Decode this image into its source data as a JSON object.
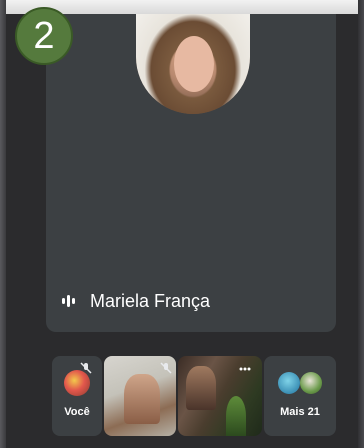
{
  "step_badge": "2",
  "main_speaker": {
    "name": "Mariela França",
    "audio_icon": "audio-level-icon"
  },
  "participants": {
    "self_label": "Você",
    "more_label": "Mais 21"
  },
  "colors": {
    "tile_background": "#3c4043",
    "badge_green": "#557a3d"
  }
}
